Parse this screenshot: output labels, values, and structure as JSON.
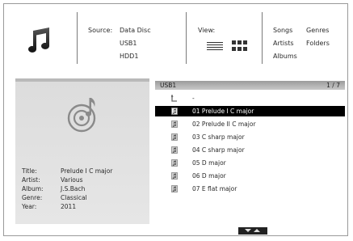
{
  "header": {
    "source": {
      "label": "Source:",
      "options": [
        "Data Disc",
        "USB1",
        "HDD1"
      ]
    },
    "view": {
      "label": "View:",
      "modes": [
        "list-view-icon",
        "grid-view-icon"
      ]
    },
    "filters": {
      "items": [
        "Songs",
        "Genres",
        "Artists",
        "Folders",
        "Albums"
      ]
    },
    "app_icon": "music-note-icon"
  },
  "info": {
    "icon": "disc-music-icon",
    "title": {
      "key": "Title:",
      "value": "Prelude I C major"
    },
    "artist": {
      "key": "Artist:",
      "value": "Various"
    },
    "album": {
      "key": "Album:",
      "value": "J.S.Bach"
    },
    "genre": {
      "key": "Genre:",
      "value": "Classical"
    },
    "year": {
      "key": "Year:",
      "value": "2011"
    }
  },
  "browser": {
    "source": "USB1",
    "page": "1 / 7",
    "up_label": "-",
    "items": [
      {
        "label": "01 Prelude I C major",
        "selected": true
      },
      {
        "label": "02 Prelude II C major",
        "selected": false
      },
      {
        "label": "03 C sharp major",
        "selected": false
      },
      {
        "label": "04 C sharp major",
        "selected": false
      },
      {
        "label": "05 D major",
        "selected": false
      },
      {
        "label": "06 D major",
        "selected": false
      },
      {
        "label": "07 E flat major",
        "selected": false
      }
    ]
  },
  "colors": {
    "selection": "#000000",
    "panel": "#e0e0e0",
    "path_bar": "#b0b0b0"
  }
}
